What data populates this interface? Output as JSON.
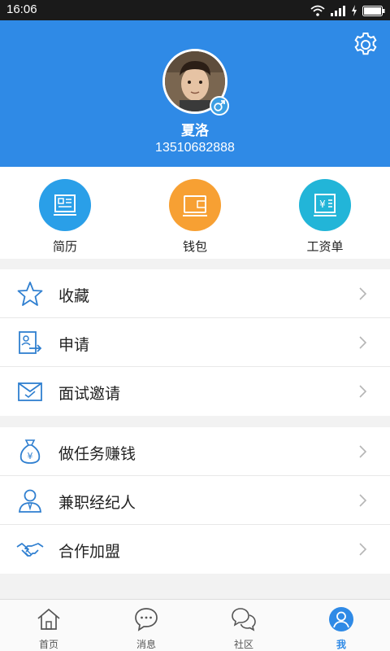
{
  "status_bar": {
    "time": "16:06"
  },
  "profile": {
    "name": "夏洛",
    "phone": "13510682888"
  },
  "quick_actions": [
    {
      "label": "简历",
      "color": "#2a9fe8"
    },
    {
      "label": "钱包",
      "color": "#f7a033"
    },
    {
      "label": "工资单",
      "color": "#22b5d8"
    }
  ],
  "menu_group_1": [
    {
      "label": "收藏",
      "icon": "star-icon"
    },
    {
      "label": "申请",
      "icon": "apply-icon"
    },
    {
      "label": "面试邀请",
      "icon": "envelope-icon"
    }
  ],
  "menu_group_2": [
    {
      "label": "做任务赚钱",
      "icon": "money-bag-icon"
    },
    {
      "label": "兼职经纪人",
      "icon": "agent-icon"
    },
    {
      "label": "合作加盟",
      "icon": "handshake-icon"
    }
  ],
  "bottom_nav": [
    {
      "label": "首页",
      "icon": "home-icon"
    },
    {
      "label": "消息",
      "icon": "message-icon"
    },
    {
      "label": "社区",
      "icon": "community-icon"
    },
    {
      "label": "我",
      "icon": "profile-icon",
      "active": true
    }
  ],
  "colors": {
    "header": "#2f8ae6",
    "accent": "#2f8ae6"
  }
}
